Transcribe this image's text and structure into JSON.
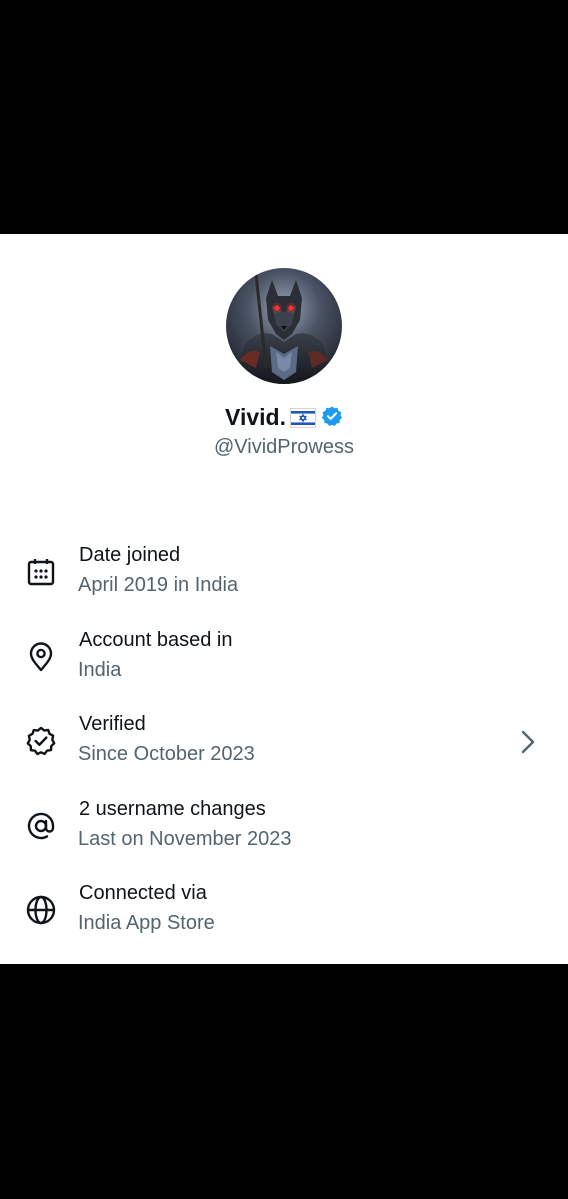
{
  "profile": {
    "display_name": "Vivid.",
    "flag_icon": "israel-flag-icon",
    "verified_icon": "verified-badge-icon",
    "handle": "@VividProwess",
    "avatar_icon": "wolf-warrior-avatar"
  },
  "details": [
    {
      "icon": "calendar-icon",
      "title": "Date joined",
      "subtitle": "April 2019 in India"
    },
    {
      "icon": "location-pin-icon",
      "title": "Account based in",
      "subtitle": "India"
    },
    {
      "icon": "verified-check-icon",
      "title": "Verified",
      "subtitle": "Since October 2023",
      "chevron": "chevron-right-icon"
    },
    {
      "icon": "at-sign-icon",
      "title": "2 username changes",
      "subtitle": "Last on November 2023"
    },
    {
      "icon": "globe-icon",
      "title": "Connected via",
      "subtitle": "India App Store"
    }
  ],
  "colors": {
    "primary_text": "#0f1419",
    "secondary_text": "#536471",
    "verified_blue": "#1d9bf0",
    "background": "#ffffff",
    "letterbox": "#000000"
  }
}
